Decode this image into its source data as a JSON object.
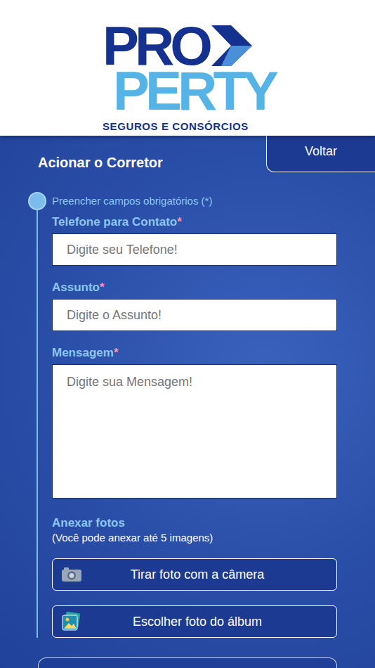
{
  "logo": {
    "top": "PRO",
    "bottom": "PERTY",
    "tagline": "SEGUROS E CONSÓRCIOS"
  },
  "header": {
    "title": "Acionar o Corretor",
    "back": "Voltar"
  },
  "form": {
    "hint": "Preencher campos obrigatórios (*)",
    "fields": [
      {
        "label": "Telefone para Contato",
        "required": "*",
        "placeholder": "Digite seu Telefone!",
        "kind": "input"
      },
      {
        "label": "Assunto",
        "required": "*",
        "placeholder": "Digite o Assunto!",
        "kind": "input"
      },
      {
        "label": "Mensagem",
        "required": "*",
        "placeholder": "Digite sua Mensagem!",
        "kind": "textarea"
      }
    ]
  },
  "attachments": {
    "title": "Anexar fotos",
    "note": "(Você pode anexar até 5 imagens)",
    "buttons": [
      {
        "label": "Tirar foto com a câmera",
        "kind": "camera"
      },
      {
        "label": "Escolher foto do álbum",
        "kind": "album"
      }
    ]
  }
}
